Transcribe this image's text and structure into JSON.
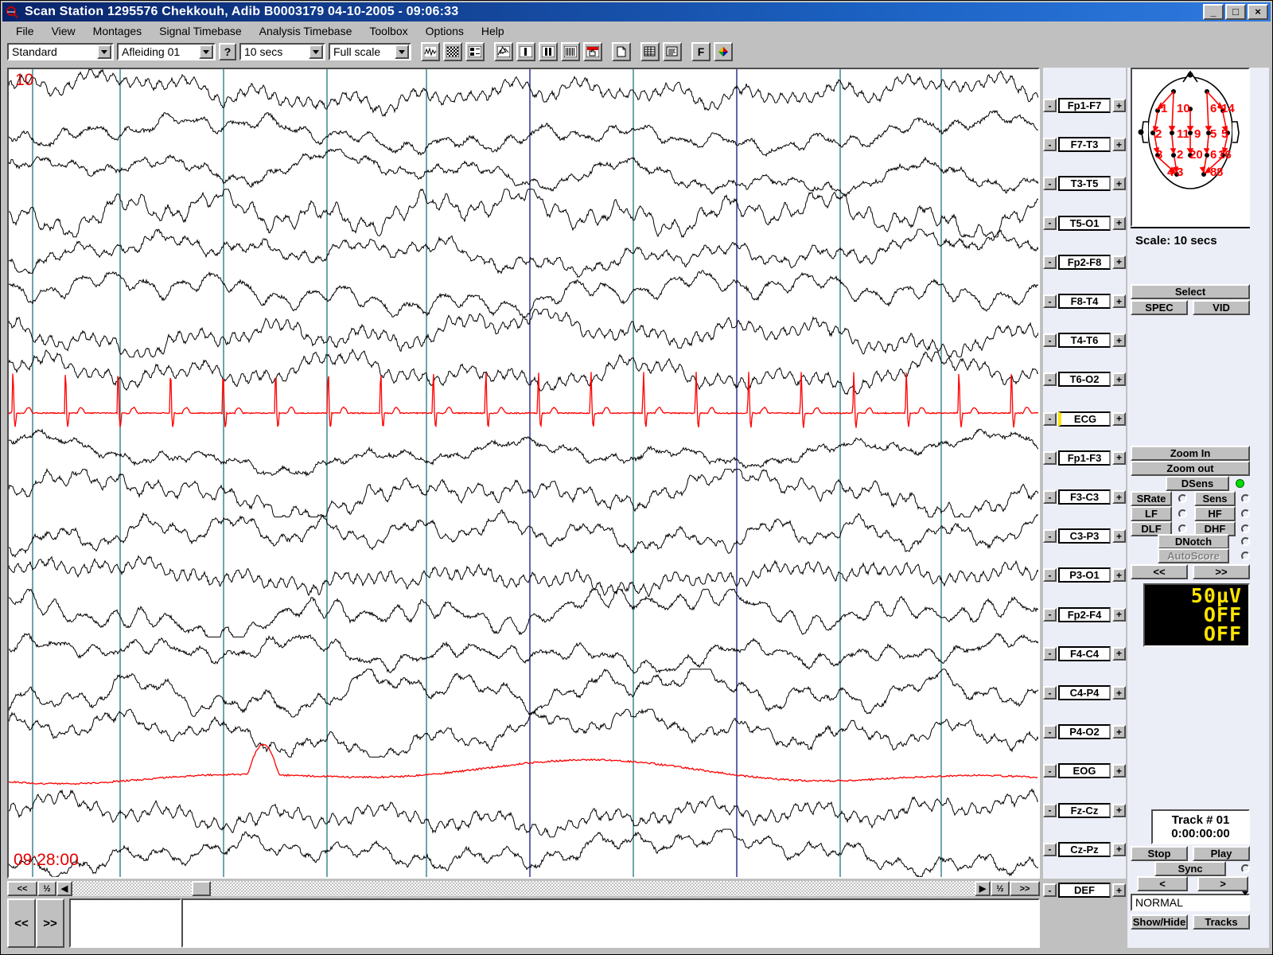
{
  "window": {
    "title": "Scan Station 1295576 Chekkouh, Adib B0003179 04-10-2005 - 09:06:33",
    "app_icon": "scan-station-icon",
    "minimize_label": "_",
    "maximize_label": "□",
    "close_label": "×"
  },
  "menu": {
    "items": [
      {
        "label": "File"
      },
      {
        "label": "View"
      },
      {
        "label": "Montages"
      },
      {
        "label": "Signal Timebase"
      },
      {
        "label": "Analysis Timebase"
      },
      {
        "label": "Toolbox"
      },
      {
        "label": "Options"
      },
      {
        "label": "Help"
      }
    ]
  },
  "toolbar": {
    "montage_select": {
      "value": "Standard",
      "options": [
        "Standard"
      ]
    },
    "derivation_select": {
      "value": "Afleiding 01",
      "options": [
        "Afleiding 01"
      ]
    },
    "help_button": "?",
    "timebase_select": {
      "value": "10 secs",
      "options": [
        "10 secs"
      ]
    },
    "scale_select": {
      "value": "Full scale",
      "options": [
        "Full scale"
      ]
    },
    "icons": [
      {
        "name": "waveform-icon",
        "label": ""
      },
      {
        "name": "spectrogram-icon",
        "label": ""
      },
      {
        "name": "layout-icon",
        "label": ""
      },
      {
        "name": "pointer-trace-icon",
        "label": ""
      },
      {
        "name": "single-bar-icon",
        "label": ""
      },
      {
        "name": "double-bar-icon",
        "label": ""
      },
      {
        "name": "multi-bar-icon",
        "label": ""
      },
      {
        "name": "red-hand-icon",
        "label": ""
      },
      {
        "name": "page-icon",
        "label": ""
      },
      {
        "name": "grid-icon",
        "label": ""
      },
      {
        "name": "list-icon",
        "label": ""
      },
      {
        "name": "font-icon",
        "label": "F"
      },
      {
        "name": "color-palette-icon",
        "label": ""
      }
    ]
  },
  "traces": {
    "overlay_top_label": "10",
    "overlay_time_label": "09:28:00",
    "grid_line_color": "#2f7f8c",
    "marker_line_color": "#23238e",
    "eeg_color": "#000000",
    "special_trace_color": "#ff0000",
    "channels": [
      {
        "label": "Fp1-F7",
        "marked": false,
        "color": "#000000"
      },
      {
        "label": "F7-T3",
        "marked": false,
        "color": "#000000"
      },
      {
        "label": "T3-T5",
        "marked": false,
        "color": "#000000"
      },
      {
        "label": "T5-O1",
        "marked": false,
        "color": "#000000"
      },
      {
        "label": "Fp2-F8",
        "marked": false,
        "color": "#000000"
      },
      {
        "label": "F8-T4",
        "marked": false,
        "color": "#000000"
      },
      {
        "label": "T4-T6",
        "marked": false,
        "color": "#000000"
      },
      {
        "label": "T6-O2",
        "marked": false,
        "color": "#000000"
      },
      {
        "label": "ECG",
        "marked": true,
        "color": "#ff0000"
      },
      {
        "label": "Fp1-F3",
        "marked": false,
        "color": "#000000"
      },
      {
        "label": "F3-C3",
        "marked": false,
        "color": "#000000"
      },
      {
        "label": "C3-P3",
        "marked": false,
        "color": "#000000"
      },
      {
        "label": "P3-O1",
        "marked": false,
        "color": "#000000"
      },
      {
        "label": "Fp2-F4",
        "marked": false,
        "color": "#000000"
      },
      {
        "label": "F4-C4",
        "marked": false,
        "color": "#000000"
      },
      {
        "label": "C4-P4",
        "marked": false,
        "color": "#000000"
      },
      {
        "label": "P4-O2",
        "marked": false,
        "color": "#000000"
      },
      {
        "label": "EOG",
        "marked": false,
        "color": "#ff0000"
      },
      {
        "label": "Fz-Cz",
        "marked": false,
        "color": "#000000"
      },
      {
        "label": "Cz-Pz",
        "marked": false,
        "color": "#000000"
      }
    ],
    "minus_label": "-",
    "plus_label": "+",
    "def_row": {
      "label": "DEF",
      "minus": "-",
      "plus": "+"
    }
  },
  "head_map": {
    "title": "head-montage-diagram",
    "electrode_numbers": [
      "1",
      "2",
      "3",
      "4",
      "5",
      "6",
      "7",
      "8",
      "9",
      "10",
      "11",
      "12",
      "13",
      "14",
      "15",
      "16",
      "20"
    ],
    "scale_text": "Scale: 10 secs",
    "arrow_color": "#ff0000"
  },
  "right_panel": {
    "select_button": "Select",
    "spec_button": "SPEC",
    "vid_button": "VID",
    "zoom_in_button": "Zoom In",
    "zoom_out_button": "Zoom out",
    "dsens_button": "DSens",
    "dsens_led_color": "#00dd00",
    "srate_button": "SRate",
    "sens_button": "Sens",
    "lf_button": "LF",
    "hf_button": "HF",
    "dlf_button": "DLF",
    "dhf_button": "DHF",
    "dnotch_button": "DNotch",
    "autoscore_button": "AutoScore",
    "prev_button": "<<",
    "next_button": ">>",
    "lcd": {
      "line1": "50µV",
      "line2": "OFF",
      "line3": "OFF"
    },
    "track": {
      "name": "Track # 01",
      "time": "0:00:00:00"
    },
    "stop_button": "Stop",
    "play_button": "Play",
    "sync_button": "Sync",
    "step_back_button": "<",
    "step_fwd_button": ">",
    "mode_select": {
      "value": "NORMAL",
      "options": [
        "NORMAL"
      ]
    },
    "show_hide_button": "Show/Hide",
    "tracks_button": "Tracks"
  },
  "bottom_bar": {
    "scroll_prev": "<<",
    "scroll_half": "½",
    "scroll_left_arrow": "◀",
    "scroll_right_arrow": "▶",
    "scroll_half_right": "½",
    "scroll_next": ">>",
    "page_prev": "<<",
    "page_next": ">>",
    "note_field_1": "",
    "note_field_2": ""
  }
}
